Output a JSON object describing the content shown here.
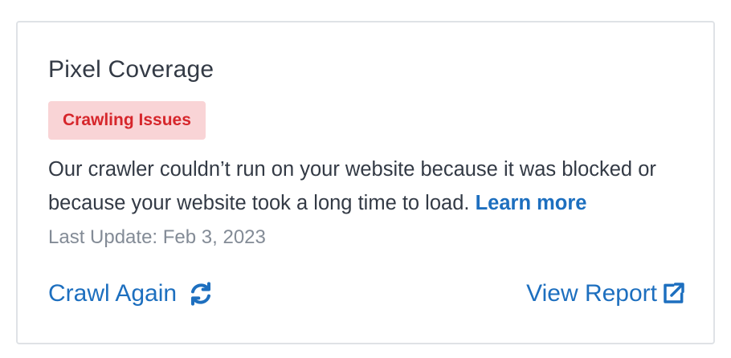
{
  "card": {
    "title": "Pixel Coverage",
    "badge": "Crawling Issues",
    "description": "Our crawler couldn’t run on your website because it was blocked or because your website took a long time to load.",
    "learn_more": "Learn more",
    "last_update": "Last Update: Feb 3, 2023",
    "crawl_again": "Crawl Again",
    "crawl_again_icon": "refresh-icon",
    "view_report": "View Report",
    "view_report_icon": "external-link-icon"
  },
  "colors": {
    "accent": "#1d6fbf",
    "badge_bg": "#f9d4d6",
    "badge_text": "#d6262b",
    "text": "#333a45",
    "muted": "#838b96",
    "border": "#dfe2e6"
  }
}
